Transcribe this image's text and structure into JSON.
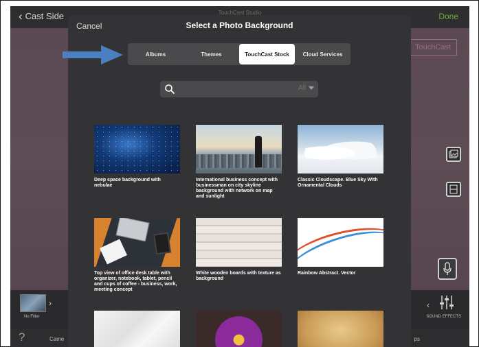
{
  "app": {
    "back_label": "Cast Side",
    "title": "TouchCast Studio",
    "done_label": "Done",
    "stage_label": "TouchCast",
    "filter_label": "No Filter",
    "sound_effects_label": "SOUND EFFECTS",
    "help_glyph": "?",
    "camera_label": "Came",
    "props_label": "ps"
  },
  "modal": {
    "cancel_label": "Cancel",
    "title": "Select a Photo Background",
    "tabs": [
      {
        "label": "Albums",
        "selected": false
      },
      {
        "label": "Themes",
        "selected": false
      },
      {
        "label": "TouchCast Stock",
        "selected": true
      },
      {
        "label": "Cloud Services",
        "selected": false
      }
    ],
    "search": {
      "value": "",
      "placeholder": "",
      "filter_value": "All"
    },
    "photos": [
      {
        "caption": "Deep space background with nebulae",
        "icon": "space-photo"
      },
      {
        "caption": "International business concept with businessman on city skyline background with network on map and sunlight",
        "icon": "business-photo"
      },
      {
        "caption": "Classic Cloudscape. Blue Sky With Ornamental Clouds",
        "icon": "clouds-photo"
      },
      {
        "caption": "Top view of office desk table with organizer, notebook, tablet, pencil and cups of coffee - business, work, meeting concept",
        "icon": "desk-photo"
      },
      {
        "caption": "White wooden boards with texture as background",
        "icon": "wood-photo"
      },
      {
        "caption": "Rainbow Abstract. Vector",
        "icon": "rainbow-photo"
      },
      {
        "caption": "",
        "icon": "marble-photo"
      },
      {
        "caption": "",
        "icon": "flower-photo"
      },
      {
        "caption": "",
        "icon": "paper-photo"
      }
    ]
  },
  "colors": {
    "accent_done": "#6fae3a",
    "arrow": "#4a7fc1",
    "modal_bg": "#333335"
  }
}
